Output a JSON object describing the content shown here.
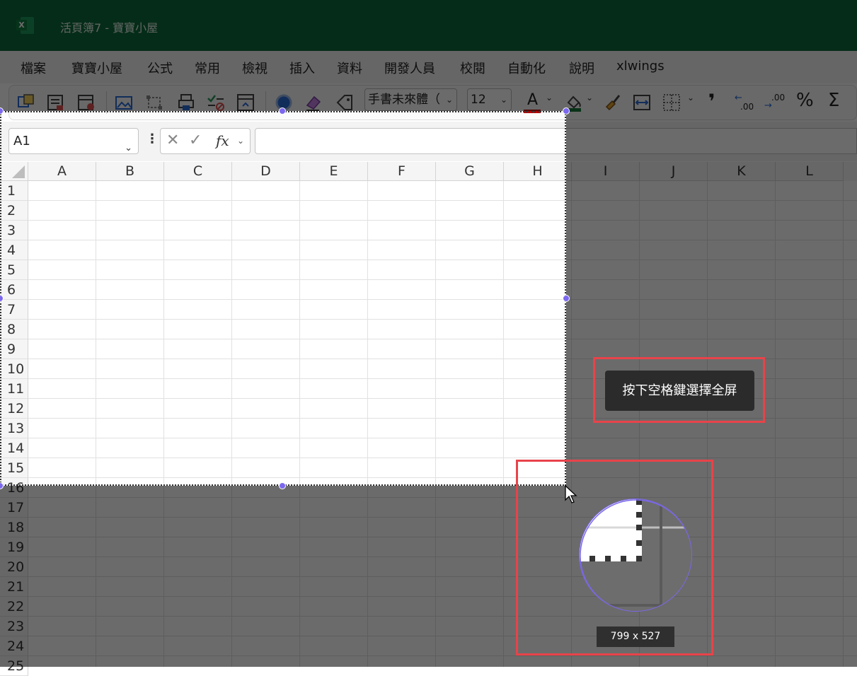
{
  "window": {
    "title": "活頁簿7  -  寶寶小屋"
  },
  "menu": {
    "items": [
      "檔案",
      "寶寶小屋",
      "公式",
      "常用",
      "檢視",
      "插入",
      "資料",
      "開發人員",
      "校閱",
      "自動化",
      "說明",
      "xlwings"
    ]
  },
  "ribbon": {
    "font_name": "手書未來體（",
    "font_size": "12",
    "icons": [
      "table-icon",
      "form-icon",
      "record-macro-icon",
      "picture-icon",
      "transform-icon",
      "print-icon",
      "checklist-icon",
      "frame-icon",
      "circle-icon",
      "eraser-icon",
      "tag-icon",
      "font-color-icon",
      "fill-color-icon",
      "format-painter-icon",
      "wrap-icon",
      "border-icon",
      "comma-icon",
      "decrease-decimal-icon",
      "increase-decimal-icon",
      "percent-icon",
      "sum-icon"
    ],
    "font_color_letter": "A",
    "percent_label": "%",
    "sum_label": "Σ",
    "comma_label": "❜",
    "dec_less": ".00",
    "dec_more": ".00"
  },
  "formula_bar": {
    "cell_ref": "A1",
    "fx_label": "fx",
    "value": ""
  },
  "grid": {
    "columns": [
      "A",
      "B",
      "C",
      "D",
      "E",
      "F",
      "G",
      "H",
      "I",
      "J",
      "K",
      "L"
    ],
    "rows": [
      "1",
      "2",
      "3",
      "4",
      "5",
      "6",
      "7",
      "8",
      "9",
      "10",
      "11",
      "12",
      "13",
      "14",
      "15",
      "16",
      "17",
      "18",
      "19",
      "20",
      "21",
      "22",
      "23",
      "24",
      "25"
    ]
  },
  "capture": {
    "hint": "按下空格鍵選擇全屏",
    "dimensions": "799 x 527"
  },
  "colors": {
    "titlebar": "#0c6a3a",
    "accent_handle": "#7b68ee",
    "callout": "#e8434a"
  }
}
